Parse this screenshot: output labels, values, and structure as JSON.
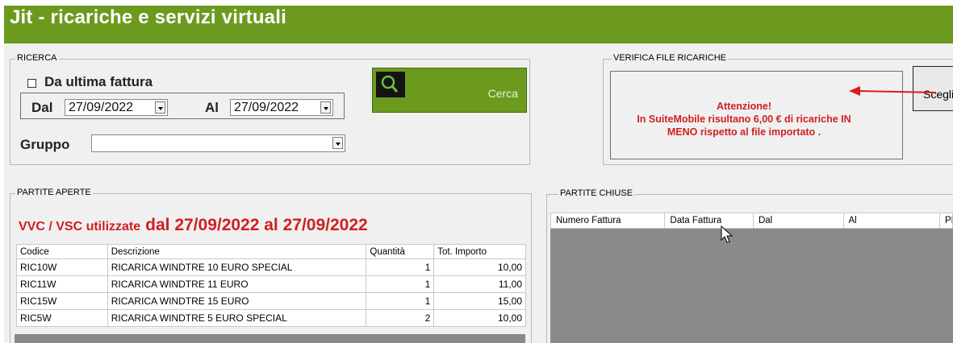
{
  "window": {
    "title": "Jit - ricariche e servizi virtuali"
  },
  "ricerca": {
    "legend": "RICERCA",
    "checkbox_label": "Da ultima fattura",
    "dal_label": "Dal",
    "dal_value": "27/09/2022",
    "al_label": "Al",
    "al_value": "27/09/2022",
    "gruppo_label": "Gruppo",
    "gruppo_value": "",
    "cerca_label": "Cerca"
  },
  "verifica": {
    "legend": "VERIFICA FILE RICARICHE",
    "alert_line1": "Attenzione!",
    "alert_line2": "In SuiteMobile risultano 6,00 € di ricariche IN",
    "alert_line3": "MENO rispetto al file importato .",
    "scegli_label": "Scegli"
  },
  "partite_aperte": {
    "legend": "PARTITE APERTE",
    "title_prefix": "VVC / VSC utilizzate",
    "title_range": "dal 27/09/2022 al 27/09/2022",
    "columns": [
      "Codice",
      "Descrizione",
      "Quantità",
      "Tot. Importo"
    ],
    "rows": [
      {
        "codice": "RIC10W",
        "descrizione": "RICARICA WINDTRE 10 EURO SPECIAL",
        "quantita": "1",
        "importo": "10,00"
      },
      {
        "codice": "RIC11W",
        "descrizione": "RICARICA WINDTRE 11 EURO",
        "quantita": "1",
        "importo": "11,00"
      },
      {
        "codice": "RIC15W",
        "descrizione": "RICARICA WINDTRE 15 EURO",
        "quantita": "1",
        "importo": "15,00"
      },
      {
        "codice": "RIC5W",
        "descrizione": "RICARICA WINDTRE 5 EURO SPECIAL",
        "quantita": "2",
        "importo": "10,00"
      }
    ]
  },
  "partite_chiuse": {
    "legend": "PARTITE CHIUSE",
    "columns": [
      "Numero Fattura",
      "Data Fattura",
      "Dal",
      "Al",
      "PD"
    ]
  },
  "colors": {
    "brand_green": "#6b9a1f",
    "alert_red": "#d11f1f"
  },
  "icons": {
    "cerca": "search-icon",
    "arrow": "red-arrow-annotation"
  }
}
